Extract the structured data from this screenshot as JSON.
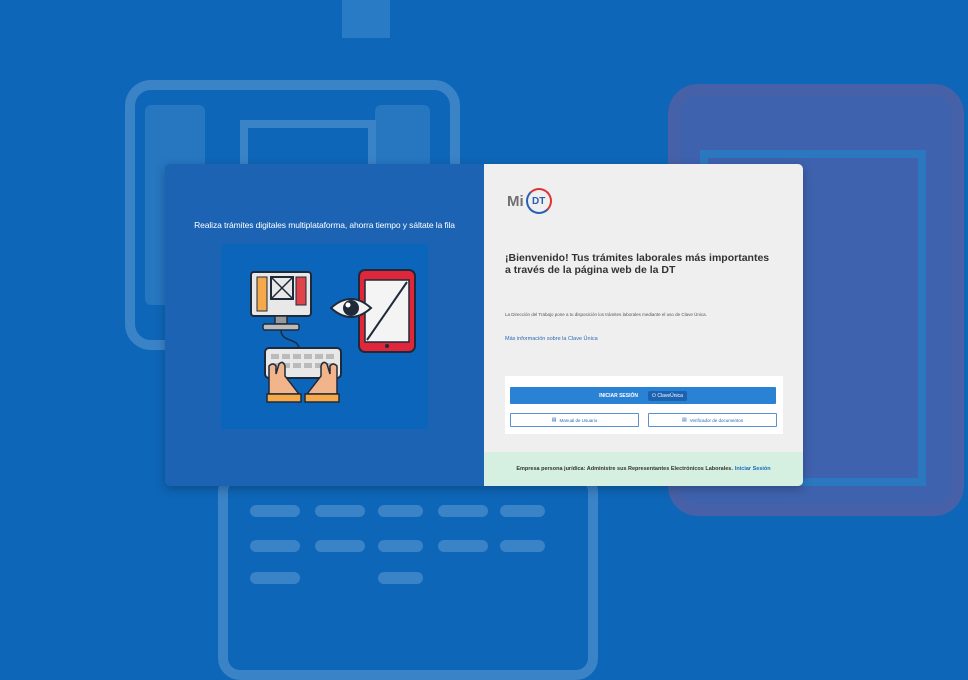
{
  "left_panel": {
    "tagline": "Realiza trámites digitales multiplataforma, ahorra tiempo y sáltate la fila"
  },
  "logo": {
    "mi": "Mi",
    "dt": "DT"
  },
  "welcome": {
    "title": "¡Bienvenido! Tus trámites laborales más importantes a través de la página web de la DT",
    "description": "La Dirección del Trabajo pone a tu disposición los trámites laborales mediante el uso de Clave Única.",
    "info_link": "Más información sobre la Clave Única"
  },
  "login": {
    "login_button": "INICIAR SESIÓN",
    "clave_unica": "ClaveÚnica",
    "manual_button": "Manual de Usuario",
    "verifier_button": "Verificador de documentos"
  },
  "footer": {
    "text": "Empresa persona jurídica: Administre sus Representantes Electrónicos Laborales.",
    "link": "Iniciar Sesión"
  },
  "colors": {
    "background": "#0e66b8",
    "left_panel": "#1d63b4",
    "primary_button": "#2a82d4",
    "footer_bg": "#d5efe0"
  }
}
